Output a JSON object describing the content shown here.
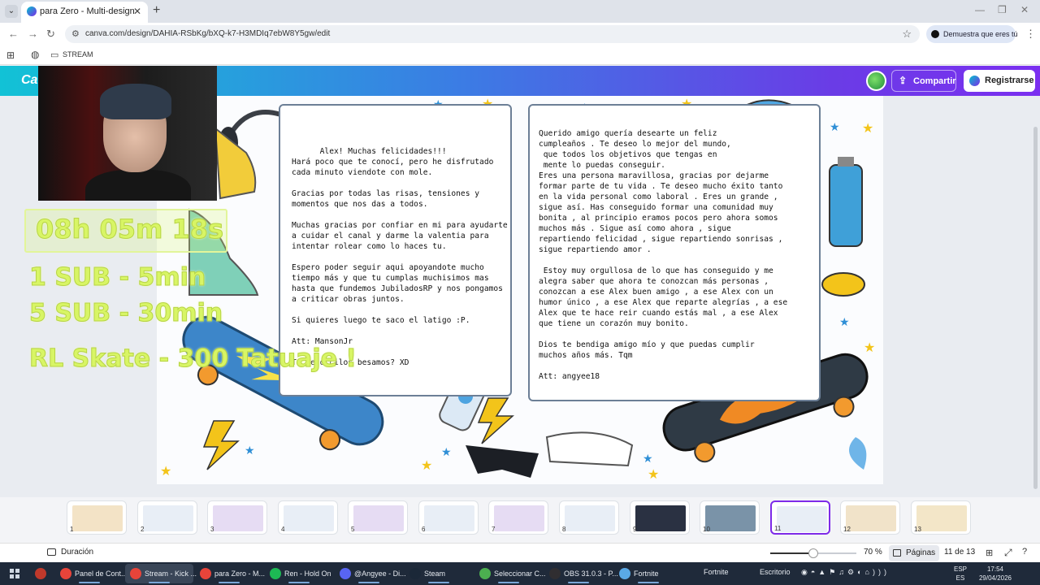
{
  "browser": {
    "tab_title": "para Zero - Multi-design",
    "url": "canva.com/design/DAHIA-RSbKg/bXQ-k7-H3MDIq7ebW8Y5gw/edit",
    "profile_label": "Demuestra que eres tú",
    "bookmark_folder": "STREAM"
  },
  "canva": {
    "logo": "Ca",
    "share_label": "Compartir",
    "register_label": "Registrarse"
  },
  "letter_left": {
    "lines": [
      "      Alex! Muchas felicidades!!!",
      "Hará poco que te conocí, pero he disfrutado",
      "cada minuto viendote con mole.",
      "",
      "Gracias por todas las risas, tensiones y",
      "momentos que nos das a todos.",
      "",
      "Muchas gracias por confiar en mi para ayudarte",
      "a cuidar el canal y darme la valentia para",
      "intentar rolear como lo haces tu.",
      "",
      "Espero poder seguir aqui apoyandote mucho",
      "tiempo más y que tu cumplas muchisimos mas",
      "hasta que fundemos JubiladosRP y nos pongamos",
      "a criticar obras juntos.",
      "",
      "Si quieres luego te saco el latigo :P.",
      "",
      "Att: MansonJr",
      "",
      "Te dejo cilos besamos? XD"
    ]
  },
  "letter_right": {
    "lines": [
      "Querido amigo quería desearte un feliz",
      "cumpleaños . Te deseo lo mejor del mundo,",
      " que todos los objetivos que tengas en",
      " mente lo puedas conseguir.",
      "Eres una persona maravillosa, gracias por dejarme",
      "formar parte de tu vida . Te deseo mucho éxito tanto",
      "en la vida personal como laboral . Eres un grande ,",
      "sigue así. Has conseguido formar una comunidad muy",
      "bonita , al principio eramos pocos pero ahora somos",
      "muchos más . Sigue así como ahora , sigue",
      "repartiendo felicidad , sigue repartiendo sonrisas ,",
      "sigue repartiendo amor .",
      "",
      " Estoy muy orgullosa de lo que has conseguido y me",
      "alegra saber que ahora te conozcan más personas ,",
      "conozcan a ese Alex buen amigo , a ese Alex con un",
      "humor único , a ese Alex que reparte alegrías , a ese",
      "Alex que te hace reir cuando estás mal , a ese Alex",
      "que tiene un corazón muy bonito.",
      "",
      "Dios te bendiga amigo mío y que puedas cumplir",
      "muchos años más. Tqm",
      "",
      "Att: angyee18"
    ]
  },
  "stream_overlay": {
    "timer": "08h 05m 18s",
    "sub1": "1 SUB - 5min",
    "sub5": "5 SUB - 30min",
    "reward": "RL Skate - 300 Tatuaje !"
  },
  "thumbnails": [
    {
      "num": "1",
      "color": "#f3e3c6"
    },
    {
      "num": "2",
      "color": "#e8eef6"
    },
    {
      "num": "3",
      "color": "#e6dcf3"
    },
    {
      "num": "4",
      "color": "#e8eef6"
    },
    {
      "num": "5",
      "color": "#e6dcf3"
    },
    {
      "num": "6",
      "color": "#e8eef6"
    },
    {
      "num": "7",
      "color": "#e6dcf3"
    },
    {
      "num": "8",
      "color": "#e8eef6"
    },
    {
      "num": "9",
      "color": "#2a3142"
    },
    {
      "num": "10",
      "color": "#7a93a8"
    },
    {
      "num": "11",
      "color": "#e8eef6"
    },
    {
      "num": "12",
      "color": "#f1e3c9"
    },
    {
      "num": "13",
      "color": "#f3e6c8"
    }
  ],
  "footer": {
    "duration_label": "Duración",
    "zoom": "70 %",
    "zoom_fraction": 0.5,
    "pages_label": "Páginas",
    "page_count": "11 de 13"
  },
  "taskbar": {
    "items": [
      {
        "label": "Panel de Cont...",
        "icon_color": "#e8443a",
        "active": false
      },
      {
        "label": "Stream - Kick ...",
        "icon_color": "#e8443a",
        "active": true
      },
      {
        "label": "para Zero - M...",
        "icon_color": "#e8443a",
        "active": false
      },
      {
        "label": "Ren - Hold On",
        "icon_color": "#1db954",
        "active": false
      },
      {
        "label": "@Angyee - Di...",
        "icon_color": "#5865f2",
        "active": false
      },
      {
        "label": "Steam",
        "icon_color": "#1b2838",
        "active": false
      },
      {
        "label": "Seleccionar C...",
        "icon_color": "#4caf50",
        "active": false
      },
      {
        "label": "OBS 31.0.3 - P...",
        "icon_color": "#302e31",
        "active": false
      },
      {
        "label": "Fortnite",
        "icon_color": "#5aa9e6",
        "active": false
      }
    ],
    "fortnite_text": "Fortnite",
    "desktop_label": "Escritorio",
    "lang_top": "ESP",
    "lang_bottom": "ES",
    "time": "17:54",
    "date": "29/04/2026"
  }
}
